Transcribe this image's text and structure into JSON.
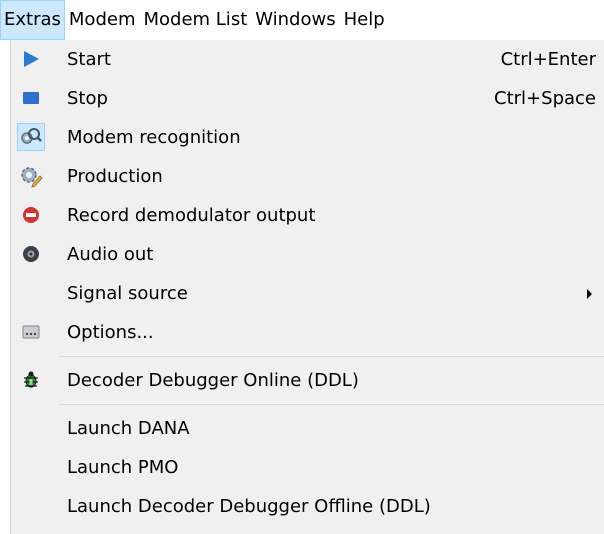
{
  "menubar": {
    "items": [
      "Extras",
      "Modem",
      "Modem List",
      "Windows",
      "Help"
    ]
  },
  "menu": {
    "items": [
      {
        "label": "Start",
        "shortcut": "Ctrl+Enter",
        "icon": "play-icon"
      },
      {
        "label": "Stop",
        "shortcut": "Ctrl+Space",
        "icon": "stop-icon"
      },
      {
        "label": "Modem recognition",
        "icon": "magnifier-gear-icon"
      },
      {
        "label": "Production",
        "icon": "gear-pencil-icon"
      },
      {
        "label": "Record demodulator output",
        "icon": "record-binary-icon"
      },
      {
        "label": "Audio out",
        "icon": "speaker-icon"
      },
      {
        "label": "Signal source",
        "submenu": true
      },
      {
        "label": "Options...",
        "icon": "options-icon"
      },
      {
        "label": "Decoder Debugger Online (DDL)",
        "icon": "bug-icon"
      },
      {
        "label": "Launch DANA"
      },
      {
        "label": "Launch PMO"
      },
      {
        "label": "Launch Decoder Debugger Offline (DDL)"
      }
    ]
  }
}
